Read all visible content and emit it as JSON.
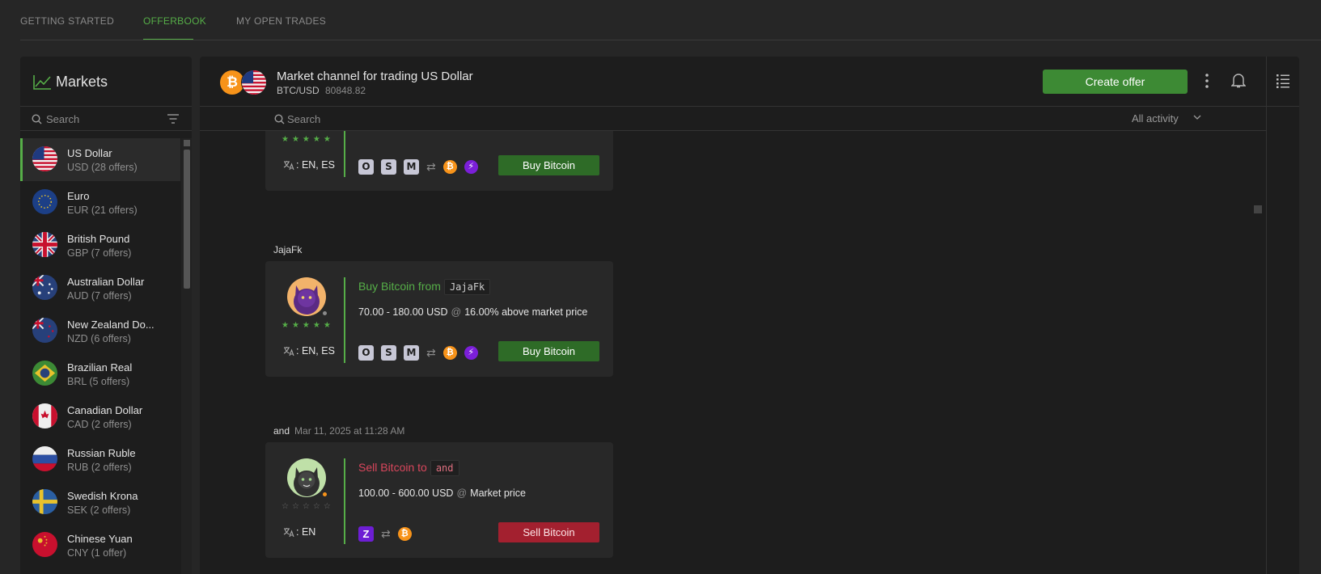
{
  "topnav": {
    "tabs": [
      {
        "label": "GETTING STARTED"
      },
      {
        "label": "OFFERBOOK"
      },
      {
        "label": "MY OPEN TRADES"
      }
    ]
  },
  "sidebar": {
    "title": "Markets",
    "search_placeholder": "Search",
    "markets": [
      {
        "name": "US Dollar",
        "sub": "USD  (28 offers)"
      },
      {
        "name": "Euro",
        "sub": "EUR  (21 offers)"
      },
      {
        "name": "British Pound",
        "sub": "GBP  (7 offers)"
      },
      {
        "name": "Australian Dollar",
        "sub": "AUD  (7 offers)"
      },
      {
        "name": "New Zealand Do...",
        "sub": "NZD  (6 offers)"
      },
      {
        "name": "Brazilian Real",
        "sub": "BRL  (5 offers)"
      },
      {
        "name": "Canadian Dollar",
        "sub": "CAD  (2 offers)"
      },
      {
        "name": "Russian Ruble",
        "sub": "RUB  (2 offers)"
      },
      {
        "name": "Swedish Krona",
        "sub": "SEK  (2 offers)"
      },
      {
        "name": "Chinese Yuan",
        "sub": "CNY  (1 offer)"
      }
    ]
  },
  "channel": {
    "title": "Market channel for trading US Dollar",
    "pair": "BTC/USD",
    "price": "80848.82",
    "create_offer_label": "Create offer",
    "search_placeholder": "Search",
    "activity_filter": "All activity"
  },
  "offers": [
    {
      "author": "",
      "timestamp": "",
      "stars": "★★★★★",
      "languages": ": EN, ES",
      "methods": [
        "O",
        "S",
        "M"
      ],
      "action_label": "Buy Bitcoin"
    },
    {
      "author": "JajaFk",
      "timestamp": "",
      "headline": "Buy Bitcoin from",
      "username": "JajaFk",
      "amount": "70.00 - 180.00 USD",
      "at": "@",
      "price_text": "16.00% above market price",
      "stars": "★★★★★",
      "languages": ": EN, ES",
      "methods": [
        "O",
        "S",
        "M"
      ],
      "action_label": "Buy Bitcoin"
    },
    {
      "author": "and",
      "timestamp": "Mar 11, 2025 at 11:28 AM",
      "headline": "Sell Bitcoin to",
      "username": "and",
      "amount": "100.00 - 600.00 USD",
      "at": "@",
      "price_text": "Market price",
      "stars": "☆☆☆☆☆",
      "languages": ": EN",
      "methods": [
        "Z"
      ],
      "action_label": "Sell Bitcoin"
    }
  ],
  "colors": {
    "accent_green": "#56ae48",
    "buy_button": "#2e6b27",
    "sell_button": "#a3202f",
    "sell_text": "#d9465c",
    "bitcoin_orange": "#f7931a",
    "lightning_purple": "#7b1fd9"
  },
  "icons": {
    "markets": "chart-line-icon",
    "search": "search-icon",
    "filter": "filter-icon",
    "more": "vertical-dots-icon",
    "notifications": "bell-icon",
    "list": "list-icon",
    "language": "translate-icon",
    "exchange": "exchange-arrows-icon",
    "bitcoin": "bitcoin-icon",
    "lightning": "lightning-icon"
  }
}
